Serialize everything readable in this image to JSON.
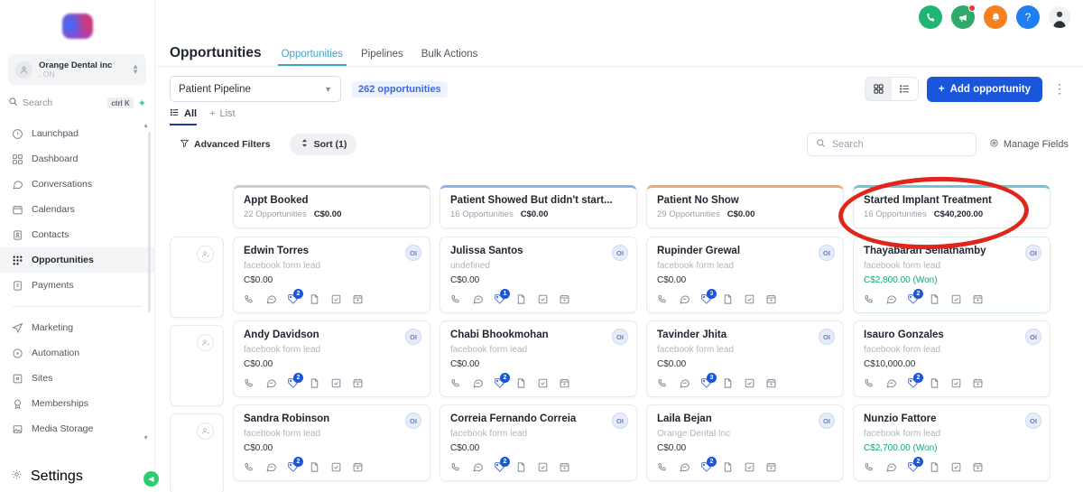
{
  "sidebar": {
    "logo_name": "app-logo",
    "account": {
      "name": "Orange Dental inc",
      "sub": ", ON"
    },
    "search": {
      "placeholder": "Search",
      "shortcut": "ctrl K"
    },
    "items": [
      {
        "label": "Launchpad",
        "icon": "rocket-icon"
      },
      {
        "label": "Dashboard",
        "icon": "grid-icon"
      },
      {
        "label": "Conversations",
        "icon": "chat-icon"
      },
      {
        "label": "Calendars",
        "icon": "calendar-icon"
      },
      {
        "label": "Contacts",
        "icon": "contacts-icon"
      },
      {
        "label": "Opportunities",
        "icon": "opportunities-icon"
      },
      {
        "label": "Payments",
        "icon": "payments-icon"
      }
    ],
    "items2": [
      {
        "label": "Marketing",
        "icon": "send-icon"
      },
      {
        "label": "Automation",
        "icon": "play-circle-icon"
      },
      {
        "label": "Sites",
        "icon": "sites-icon"
      },
      {
        "label": "Memberships",
        "icon": "membership-icon"
      },
      {
        "label": "Media Storage",
        "icon": "image-icon"
      }
    ],
    "settings": {
      "label": "Settings",
      "icon": "gear-icon"
    }
  },
  "topbar": {
    "icons": [
      {
        "name": "phone-icon",
        "glyph": "✆",
        "color": "#21b573"
      },
      {
        "name": "megaphone-icon",
        "glyph": "📣",
        "color": "#2faa6b",
        "badge": true
      },
      {
        "name": "bell-icon",
        "glyph": "🔔",
        "color": "#f4801f"
      },
      {
        "name": "help-icon",
        "glyph": "?",
        "color": "#1d7ff0"
      },
      {
        "name": "user-avatar",
        "glyph": "",
        "color": "#f0f1f3"
      }
    ]
  },
  "header": {
    "title": "Opportunities",
    "tabs": [
      {
        "label": "Opportunities",
        "active": true
      },
      {
        "label": "Pipelines",
        "active": false
      },
      {
        "label": "Bulk Actions",
        "active": false
      }
    ]
  },
  "filters": {
    "pipeline_value": "Patient Pipeline",
    "opportunity_count": "262 opportunities",
    "view_kanban": "kanban-view",
    "view_list": "list-view",
    "add_button": "Add opportunity",
    "plus": "+",
    "list_tabs": [
      {
        "label": "All",
        "active": true
      },
      {
        "label": "List",
        "active": false
      }
    ],
    "advanced_filters": "Advanced Filters",
    "sort": "Sort (1)",
    "search_placeholder": "Search",
    "manage_fields": "Manage Fields"
  },
  "annotation": {
    "shape": "red-ellipse",
    "color": "#e0251c",
    "target": "Started Implant Treatment"
  },
  "board": {
    "columns": [
      {
        "id": "partial-left",
        "partial": true,
        "title": "",
        "count": "",
        "sum": "",
        "accent": "#e8eaed",
        "cards": []
      },
      {
        "id": "appt-booked",
        "partial": false,
        "title": "Appt Booked",
        "count": "22 Opportunities",
        "sum": "C$0.00",
        "accent": "#c9ced4",
        "cards": [
          {
            "name": "Edwin Torres",
            "source": "facebook form lead",
            "value": "C$0.00",
            "won": false,
            "badge": "OI",
            "tag_count": "2"
          },
          {
            "name": "Andy Davidson",
            "source": "facebook form lead",
            "value": "C$0.00",
            "won": false,
            "badge": "OI",
            "tag_count": "2"
          },
          {
            "name": "Sandra Robinson",
            "source": "facebook form lead",
            "value": "C$0.00",
            "won": false,
            "badge": "OI",
            "tag_count": "2"
          }
        ]
      },
      {
        "id": "patient-showed",
        "partial": false,
        "title": "Patient Showed But didn't start...",
        "count": "16 Opportunities",
        "sum": "C$0.00",
        "accent": "#8fb3e8",
        "cards": [
          {
            "name": "Julissa Santos",
            "source": "undefined",
            "value": "C$0.00",
            "won": false,
            "badge": "OI",
            "tag_count": "1"
          },
          {
            "name": "Chabi Bhookmohan",
            "source": "facebook form lead",
            "value": "C$0.00",
            "won": false,
            "badge": "OI",
            "tag_count": "2"
          },
          {
            "name": "Correia Fernando Correia",
            "source": "facebook form lead",
            "value": "C$0.00",
            "won": false,
            "badge": "OI",
            "tag_count": "2"
          }
        ]
      },
      {
        "id": "patient-no-show",
        "partial": false,
        "title": "Patient No Show",
        "count": "29 Opportunities",
        "sum": "C$0.00",
        "accent": "#f0a868",
        "cards": [
          {
            "name": "Rupinder Grewal",
            "source": "facebook form lead",
            "value": "C$0.00",
            "won": false,
            "badge": "OI",
            "tag_count": "3"
          },
          {
            "name": "Tavinder Jhita",
            "source": "facebook form lead",
            "value": "C$0.00",
            "won": false,
            "badge": "OI",
            "tag_count": "3"
          },
          {
            "name": "Laila Bejan",
            "source": "Orange Dental Inc",
            "value": "C$0.00",
            "won": false,
            "badge": "OI",
            "tag_count": "2"
          }
        ]
      },
      {
        "id": "started-implant-treatment",
        "partial": false,
        "title": "Started Implant Treatment",
        "count": "16 Opportunities",
        "sum": "C$40,200.00",
        "accent": "#6fc5d6",
        "cards": [
          {
            "name": "Thayabaran Sellathamby",
            "source": "facebook form lead",
            "value": "C$2,800.00 (Won)",
            "won": true,
            "badge": "OI",
            "tag_count": "2"
          },
          {
            "name": "Isauro Gonzales",
            "source": "facebook form lead",
            "value": "C$10,000.00",
            "won": false,
            "badge": "OI",
            "tag_count": "2"
          },
          {
            "name": "Nunzio Fattore",
            "source": "facebook form lead",
            "value": "C$2,700.00 (Won)",
            "won": true,
            "badge": "OI",
            "tag_count": "2"
          }
        ]
      }
    ],
    "card_icons": [
      "phone-icon",
      "chat-icon",
      "tag-icon",
      "document-icon",
      "task-icon",
      "calendar-icon"
    ]
  }
}
